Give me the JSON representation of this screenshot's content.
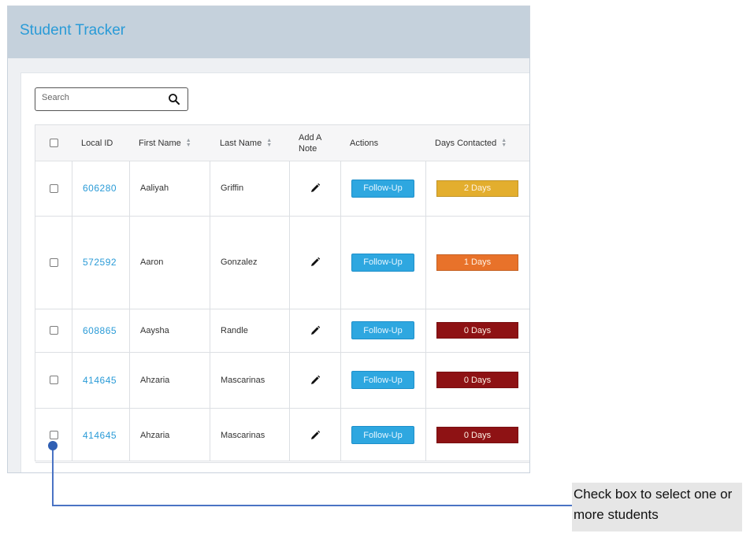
{
  "app": {
    "title": "Student Tracker"
  },
  "search": {
    "placeholder": "Search"
  },
  "columns": {
    "local_id": "Local ID",
    "first_name": "First Name",
    "last_name": "Last Name",
    "add_note": "Add A Note",
    "actions": "Actions",
    "days_contacted": "Days Contacted"
  },
  "rows": [
    {
      "local_id": "606280",
      "first_name": "Aaliyah",
      "last_name": "Griffin",
      "action": "Follow-Up",
      "days": "2 Days",
      "days_color": "#e3ae2e"
    },
    {
      "local_id": "572592",
      "first_name": "Aaron",
      "last_name": "Gonzalez",
      "action": "Follow-Up",
      "days": "1 Days",
      "days_color": "#e8722a"
    },
    {
      "local_id": "608865",
      "first_name": "Aaysha",
      "last_name": "Randle",
      "action": "Follow-Up",
      "days": "0 Days",
      "days_color": "#8e1214"
    },
    {
      "local_id": "414645",
      "first_name": "Ahzaria",
      "last_name": "Mascarinas",
      "action": "Follow-Up",
      "days": "0 Days",
      "days_color": "#8e1214"
    },
    {
      "local_id": "414645",
      "first_name": "Ahzaria",
      "last_name": "Mascarinas",
      "action": "Follow-Up",
      "days": "0 Days",
      "days_color": "#8e1214"
    }
  ],
  "callout": {
    "text": "Check box to select one or more students"
  },
  "colors": {
    "accent": "#2a9bd7",
    "header_bg": "#c5d1dc",
    "connector": "#4a73c4"
  },
  "icons": {
    "search": "search-icon",
    "edit": "pencil-icon",
    "sort": "sort-icon"
  }
}
